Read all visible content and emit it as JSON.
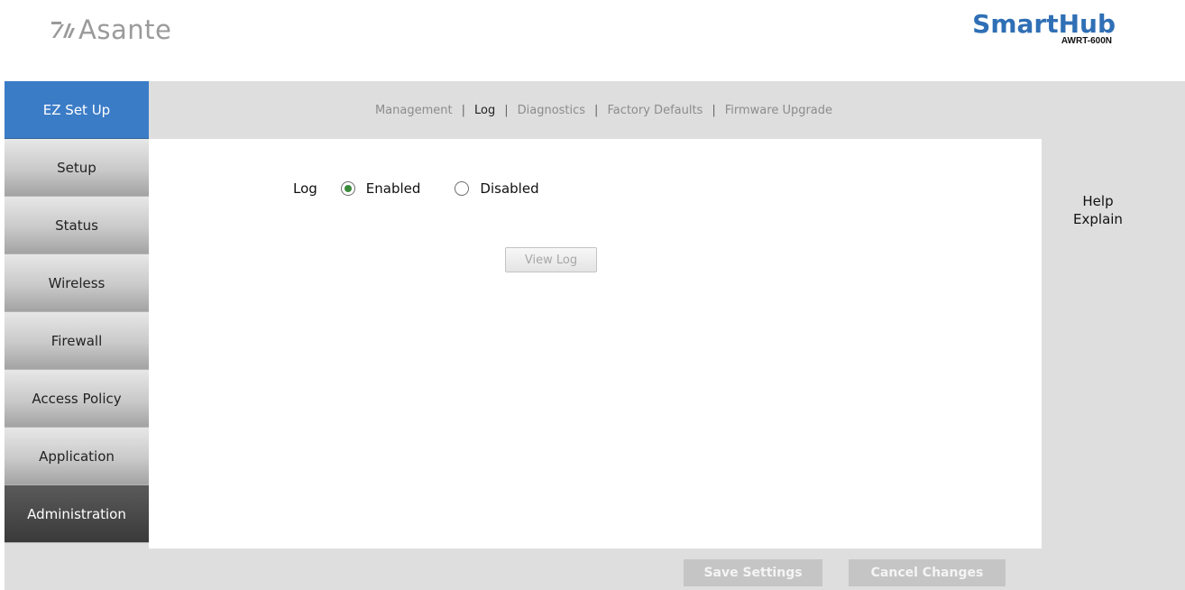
{
  "header": {
    "brand_name": "Asante",
    "product_name": "SmartHub",
    "product_model": "AWRT-600N"
  },
  "sidebar": {
    "items": [
      {
        "label": "EZ Set Up",
        "state": "highlighted"
      },
      {
        "label": "Setup"
      },
      {
        "label": "Status"
      },
      {
        "label": "Wireless"
      },
      {
        "label": "Firewall"
      },
      {
        "label": "Access Policy"
      },
      {
        "label": "Application"
      },
      {
        "label": "Administration",
        "state": "selected"
      }
    ]
  },
  "subnav": {
    "links": [
      {
        "label": "Management"
      },
      {
        "label": "Log",
        "active": true
      },
      {
        "label": "Diagnostics"
      },
      {
        "label": "Factory Defaults"
      },
      {
        "label": "Firmware Upgrade"
      }
    ],
    "separator": "|"
  },
  "content": {
    "log_label": "Log",
    "enabled_label": "Enabled",
    "disabled_label": "Disabled",
    "selected": "Enabled",
    "view_log_label": "View Log"
  },
  "help": {
    "line1": "Help",
    "line2": "Explain"
  },
  "footer": {
    "save_label": "Save Settings",
    "cancel_label": "Cancel Changes"
  },
  "colors": {
    "accent_blue": "#3b7cc7",
    "brand_blue": "#2f6fb5",
    "radio_selected": "#3c8a3c",
    "frame_grey": "#dedede"
  }
}
